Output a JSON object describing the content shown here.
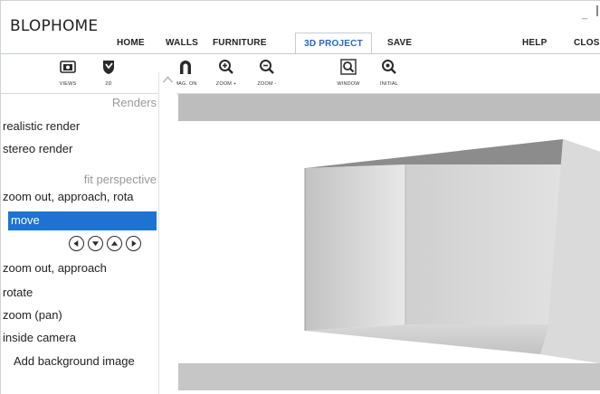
{
  "app": {
    "title": "BLOPHOME",
    "minimize_glyph": "_"
  },
  "menu": {
    "tabs": [
      {
        "label": "HOME",
        "active": false
      },
      {
        "label": "WALLS",
        "active": false
      },
      {
        "label": "FURNITURE",
        "active": false
      },
      {
        "label": "3D PROJECT",
        "active": true
      },
      {
        "label": "SAVE",
        "active": false
      },
      {
        "label": "HELP",
        "active": false
      },
      {
        "label": "CLOS",
        "active": false
      }
    ]
  },
  "toolbar": {
    "views": {
      "label": "VIEWS",
      "icon": "camera-icon"
    },
    "two_d": {
      "label": "2D",
      "icon": "shield-icon"
    },
    "mag_on": {
      "label": "MAG. ON",
      "icon": "magnet-icon"
    },
    "zoom_in": {
      "label": "ZOOM +",
      "icon": "zoom-in-icon"
    },
    "zoom_out": {
      "label": "ZOOM -",
      "icon": "zoom-out-icon"
    },
    "window": {
      "label": "WINDOW",
      "icon": "zoom-window-icon"
    },
    "initial": {
      "label": "INITIAL",
      "icon": "zoom-initial-icon"
    }
  },
  "sidebar": {
    "header": "Renders",
    "realistic_render": "realistic render",
    "stereo_render": "stereo render",
    "fit_perspective": "fit perspective",
    "zoom_out_approach_rotate": "zoom out, approach, rota",
    "move": "move",
    "move_arrows": [
      "arrow-left-icon",
      "arrow-down-icon",
      "arrow-up-icon",
      "arrow-right-icon"
    ],
    "zoom_out_approach": "zoom out, approach",
    "rotate": "rotate",
    "zoom_pan": "zoom (pan)",
    "inside_camera": "inside camera",
    "add_background": "Add background image"
  },
  "viewer": {
    "scene": "3d-room-box"
  },
  "colors": {
    "accent_blue": "#2b67c4",
    "selection_blue": "#1e73d2",
    "viewer_band": "#bdbdbd",
    "wall_light": "#e2e2e2",
    "wall_mid": "#c8c8c8",
    "ceiling": "#8c8c8c"
  }
}
